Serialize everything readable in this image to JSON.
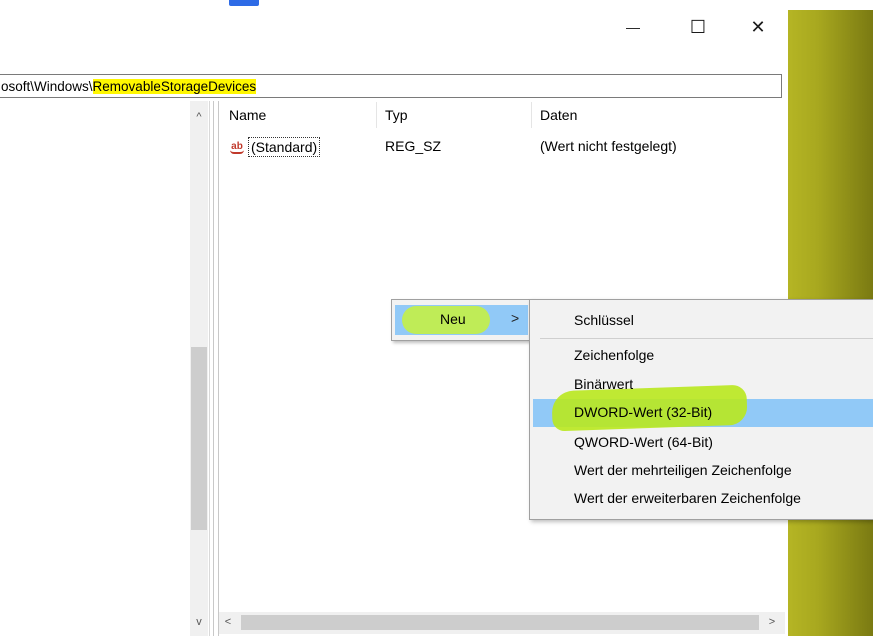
{
  "window": {
    "controls": {
      "minimize_icon": "—",
      "maximize_icon": "☐",
      "close_icon": "✕"
    }
  },
  "address_bar": {
    "prefix": "osoft\\Windows\\",
    "highlighted": "RemovableStorageDevices"
  },
  "list": {
    "columns": {
      "name": "Name",
      "type": "Typ",
      "data": "Daten"
    },
    "rows": [
      {
        "icon": "ab",
        "name": "(Standard)",
        "type": "REG_SZ",
        "data": "(Wert nicht festgelegt)"
      }
    ]
  },
  "context_menu": {
    "item": "Neu",
    "submenu_arrow": ">"
  },
  "submenu": {
    "items": [
      "Schlüssel",
      "Zeichenfolge",
      "Binärwert",
      "DWORD-Wert (32-Bit)",
      "QWORD-Wert (64-Bit)",
      "Wert der mehrteiligen Zeichenfolge",
      "Wert der erweiterbaren Zeichenfolge"
    ]
  },
  "scroll": {
    "up": "^",
    "down": "v",
    "left": "<",
    "right": ">"
  },
  "colors": {
    "highlight_yellow": "#fff700",
    "menu_hover": "#91c9f7",
    "marker_green": "#c7f23b",
    "desktop_olive": "#a8a81f"
  }
}
